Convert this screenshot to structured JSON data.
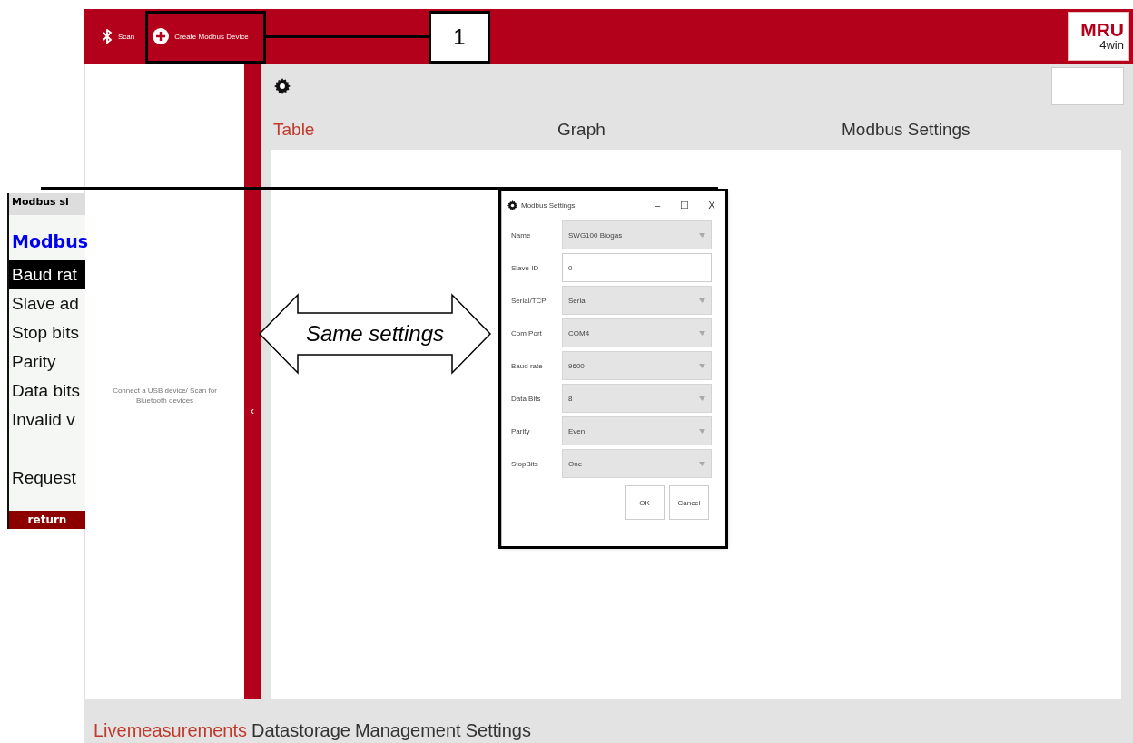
{
  "top_bar": {
    "buttons": [
      {
        "kind": "bluetooth",
        "label": "Scan"
      },
      {
        "kind": "plus",
        "label": "Create Modbus Device"
      }
    ],
    "logo": {
      "line_1": "MRU",
      "line_2": "4win"
    }
  },
  "side_panel": {
    "message": "Connect a USB device/ Scan for Bluetooth devices",
    "collapse_glyph": "‹"
  },
  "tabs": [
    {
      "label": "Table",
      "selected": true
    },
    {
      "label": "Graph",
      "selected": false
    },
    {
      "label": "Modbus Settings",
      "selected": false
    }
  ],
  "dialog": {
    "title": "Modbus Settings",
    "window_controls": [
      "–",
      "☐",
      "X"
    ],
    "fields": [
      {
        "label": "Name",
        "kind": "dropdown",
        "value": "SWG100 Biogas"
      },
      {
        "label": "Slave ID",
        "kind": "text",
        "value": "0"
      },
      {
        "label": "Serial/TCP",
        "kind": "dropdown",
        "value": "Serial"
      },
      {
        "label": "Com Port",
        "kind": "dropdown",
        "value": "COM4"
      },
      {
        "label": "Baud rate",
        "kind": "dropdown",
        "value": "9600"
      },
      {
        "label": "Data Bits",
        "kind": "dropdown",
        "value": "8"
      },
      {
        "label": "Parity",
        "kind": "dropdown",
        "value": "Even"
      },
      {
        "label": "StopBits",
        "kind": "dropdown",
        "value": "One"
      }
    ],
    "buttons": [
      "OK",
      "Cancel"
    ]
  },
  "bottom_nav": [
    {
      "label": "Livemeasurements",
      "selected": true
    },
    {
      "label": "Datastorage",
      "selected": false
    },
    {
      "label": "Management",
      "selected": false
    },
    {
      "label": "Settings",
      "selected": false
    }
  ],
  "device_screen": {
    "header": "Modbus sl",
    "title": "Modbus",
    "items": [
      {
        "label": "Baud rat",
        "selected": true
      },
      {
        "label": "Slave ad",
        "selected": false
      },
      {
        "label": "Stop bits",
        "selected": false
      },
      {
        "label": "Parity",
        "selected": false
      },
      {
        "label": "Data bits",
        "selected": false
      },
      {
        "label": "Invalid v",
        "selected": false
      }
    ],
    "request": "Request",
    "footer_button": "return"
  },
  "annotations": {
    "callout_number": "1",
    "arrow_label": "Same settings"
  }
}
